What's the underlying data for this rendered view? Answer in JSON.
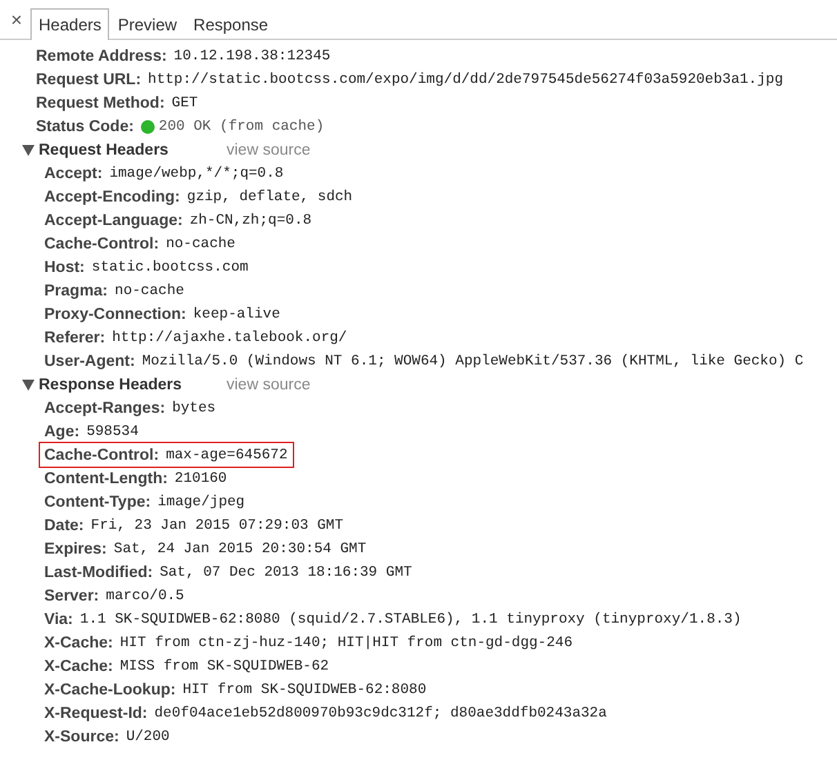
{
  "close_label": "×",
  "tabs": [
    {
      "label": "Headers",
      "selected": true
    },
    {
      "label": "Preview",
      "selected": false
    },
    {
      "label": "Response",
      "selected": false
    }
  ],
  "general": [
    {
      "name": "Remote Address:",
      "value": "10.12.198.38:12345",
      "kind": "text"
    },
    {
      "name": "Request URL:",
      "value": "http://static.bootcss.com/expo/img/d/dd/2de797545de56274f03a5920eb3a1.jpg",
      "kind": "text"
    },
    {
      "name": "Request Method:",
      "value": "GET",
      "kind": "text"
    },
    {
      "name": "Status Code:",
      "value": "200 OK (from cache)",
      "kind": "status"
    }
  ],
  "sections": [
    {
      "title": "Request Headers",
      "link": "view source",
      "expanded": true,
      "headers": [
        {
          "name": "Accept:",
          "value": "image/webp,*/*;q=0.8",
          "highlighted": false
        },
        {
          "name": "Accept-Encoding:",
          "value": "gzip, deflate, sdch",
          "highlighted": false
        },
        {
          "name": "Accept-Language:",
          "value": "zh-CN,zh;q=0.8",
          "highlighted": false
        },
        {
          "name": "Cache-Control:",
          "value": "no-cache",
          "highlighted": false
        },
        {
          "name": "Host:",
          "value": "static.bootcss.com",
          "highlighted": false
        },
        {
          "name": "Pragma:",
          "value": "no-cache",
          "highlighted": false
        },
        {
          "name": "Proxy-Connection:",
          "value": "keep-alive",
          "highlighted": false
        },
        {
          "name": "Referer:",
          "value": "http://ajaxhe.talebook.org/",
          "highlighted": false
        },
        {
          "name": "User-Agent:",
          "value": "Mozilla/5.0 (Windows NT 6.1; WOW64) AppleWebKit/537.36 (KHTML, like Gecko) C",
          "highlighted": false
        }
      ]
    },
    {
      "title": "Response Headers",
      "link": "view source",
      "expanded": true,
      "headers": [
        {
          "name": "Accept-Ranges:",
          "value": "bytes",
          "highlighted": false
        },
        {
          "name": "Age:",
          "value": "598534",
          "highlighted": false
        },
        {
          "name": "Cache-Control:",
          "value": "max-age=645672",
          "highlighted": true
        },
        {
          "name": "Content-Length:",
          "value": "210160",
          "highlighted": false
        },
        {
          "name": "Content-Type:",
          "value": "image/jpeg",
          "highlighted": false
        },
        {
          "name": "Date:",
          "value": "Fri, 23 Jan 2015 07:29:03 GMT",
          "highlighted": false
        },
        {
          "name": "Expires:",
          "value": "Sat, 24 Jan 2015 20:30:54 GMT",
          "highlighted": false
        },
        {
          "name": "Last-Modified:",
          "value": "Sat, 07 Dec 2013 18:16:39 GMT",
          "highlighted": false
        },
        {
          "name": "Server:",
          "value": "marco/0.5",
          "highlighted": false
        },
        {
          "name": "Via:",
          "value": "1.1 SK-SQUIDWEB-62:8080 (squid/2.7.STABLE6), 1.1 tinyproxy (tinyproxy/1.8.3)",
          "highlighted": false
        },
        {
          "name": "X-Cache:",
          "value": "HIT from ctn-zj-huz-140; HIT|HIT from ctn-gd-dgg-246",
          "highlighted": false
        },
        {
          "name": "X-Cache:",
          "value": "MISS from SK-SQUIDWEB-62",
          "highlighted": false
        },
        {
          "name": "X-Cache-Lookup:",
          "value": "HIT from SK-SQUIDWEB-62:8080",
          "highlighted": false
        },
        {
          "name": "X-Request-Id:",
          "value": "de0f04ace1eb52d800970b93c9dc312f; d80ae3ddfb0243a32a",
          "highlighted": false
        },
        {
          "name": "X-Source:",
          "value": "U/200",
          "highlighted": false
        }
      ]
    }
  ]
}
